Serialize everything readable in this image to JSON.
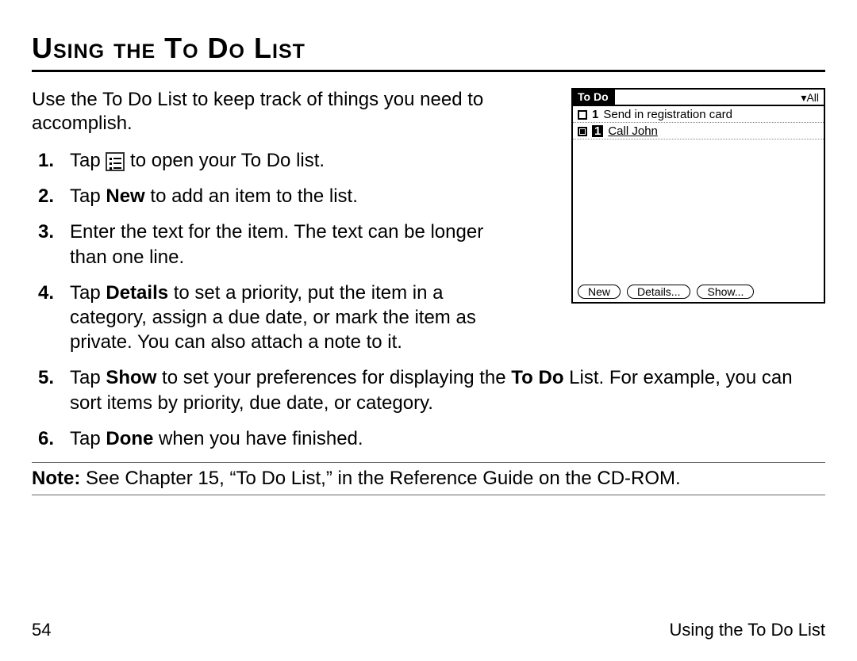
{
  "heading": "Using the To Do List",
  "intro": "Use the To Do List to keep track of things you need to accomplish.",
  "steps": {
    "s1_a": "Tap ",
    "s1_b": " to open your To Do list.",
    "s2_a": "Tap ",
    "s2_new": "New",
    "s2_b": " to add an item to the list.",
    "s3": "Enter the text for the item. The text can be longer than one line.",
    "s4_a": "Tap ",
    "s4_details": "Details",
    "s4_b": " to set a priority, put the item in a category, assign a due date, or mark the item as private. You can also attach a note to it.",
    "s5_a": "Tap ",
    "s5_show": "Show",
    "s5_b": " to set your preferences for displaying the ",
    "s5_todo": "To Do",
    "s5_c": " List. For example, you can sort items by priority, due date, or category.",
    "s6_a": "Tap ",
    "s6_done": "Done",
    "s6_b": " when you have finished."
  },
  "note": {
    "label": "Note:",
    "text": " See Chapter 15, “To Do List,” in the Reference Guide on the CD-ROM."
  },
  "footer": {
    "page": "54",
    "section": "Using the To Do List"
  },
  "device": {
    "title": "To Do",
    "filter": "All",
    "items": [
      {
        "priority": "1",
        "text": "Send in registration card",
        "selected": false
      },
      {
        "priority": "1",
        "text": "Call John",
        "selected": true
      }
    ],
    "buttons": {
      "new": "New",
      "details": "Details...",
      "show": "Show..."
    }
  }
}
